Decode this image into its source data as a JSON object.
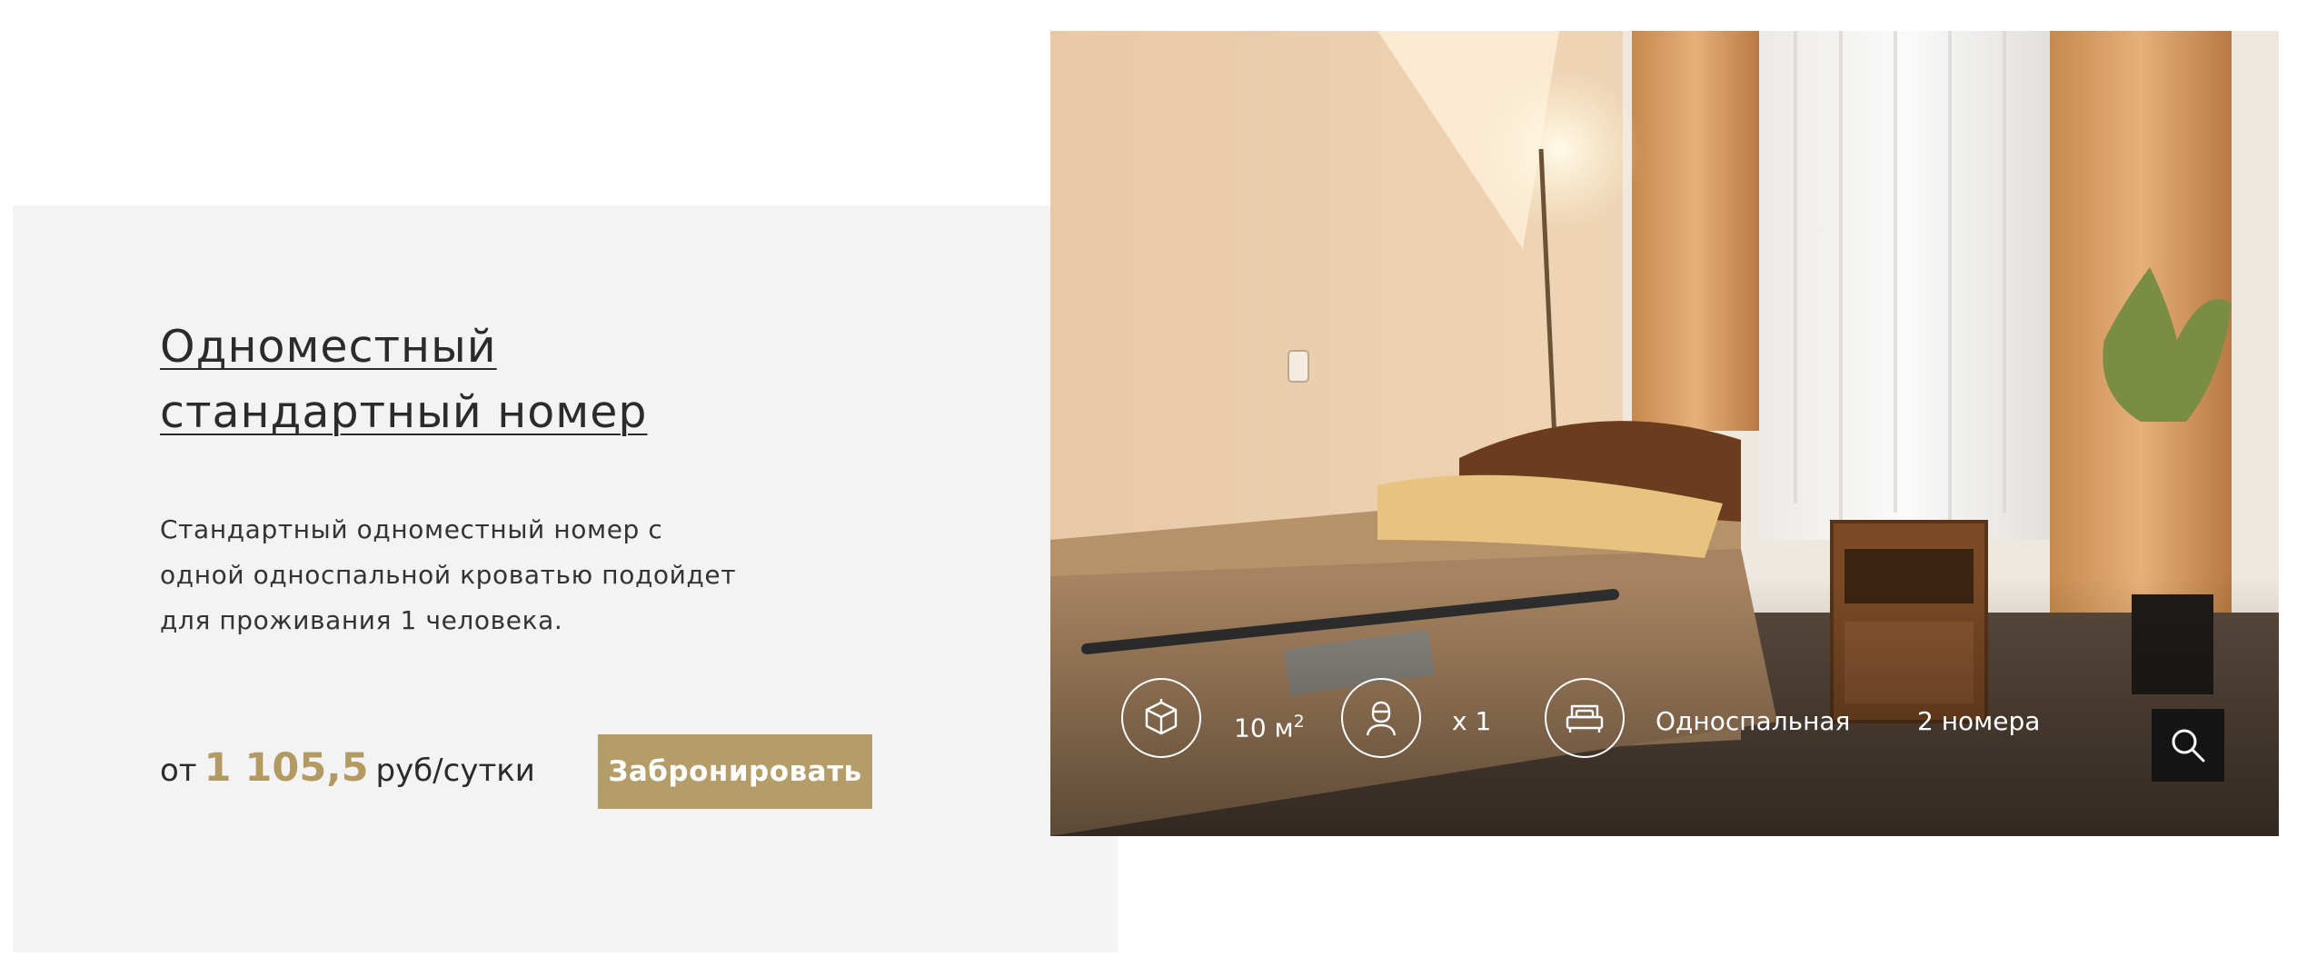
{
  "room": {
    "title": "Одноместный стандартный номер",
    "description": "Стандартный одноместный номер с одной односпальной кроватью подойдет для проживания 1 человека.",
    "price_prefix": "от",
    "price_value": "1 105,5",
    "price_unit": "руб/сутки",
    "book_label": "Забронировать"
  },
  "stats": {
    "area_value": "10 м",
    "area_sup": "2",
    "guests": "x 1",
    "bed": "Односпальная",
    "rooms_count": "2 номера"
  },
  "icons": {
    "area": "cube-icon",
    "guests": "person-icon",
    "bed": "bed-icon",
    "zoom": "search-icon"
  },
  "colors": {
    "accent": "#b49d68",
    "panel": "#f3f3f3",
    "zoom_button": "#141414"
  }
}
